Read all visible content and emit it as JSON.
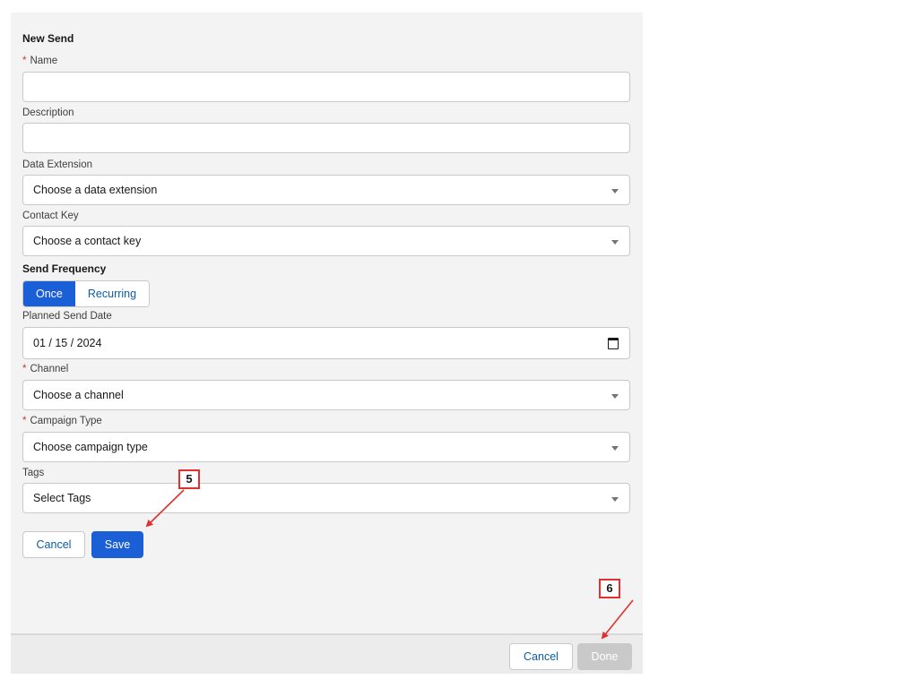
{
  "form": {
    "title": "New Send",
    "required_mark": "*",
    "name": {
      "label": "Name",
      "value": ""
    },
    "description": {
      "label": "Description",
      "value": ""
    },
    "data_extension": {
      "label": "Data Extension",
      "value": "Choose a data extension"
    },
    "contact_key": {
      "label": "Contact Key",
      "value": "Choose a contact key"
    },
    "send_frequency": {
      "label": "Send Frequency",
      "options": [
        "Once",
        "Recurring"
      ],
      "selected": "Once"
    },
    "planned_send_date": {
      "label": "Planned Send Date",
      "value": "01 / 15 / 2024"
    },
    "channel": {
      "label": "Channel",
      "value": "Choose a channel"
    },
    "campaign_type": {
      "label": "Campaign Type",
      "value": "Choose campaign type"
    },
    "tags": {
      "label": "Tags",
      "value": "Select Tags"
    },
    "cancel_label": "Cancel",
    "save_label": "Save"
  },
  "footer": {
    "cancel_label": "Cancel",
    "done_label": "Done"
  },
  "annotations": {
    "step_5": "5",
    "step_6": "6"
  },
  "colors": {
    "brand": "#1b5fd6",
    "required": "#c23934",
    "annotation": "#e03030"
  }
}
